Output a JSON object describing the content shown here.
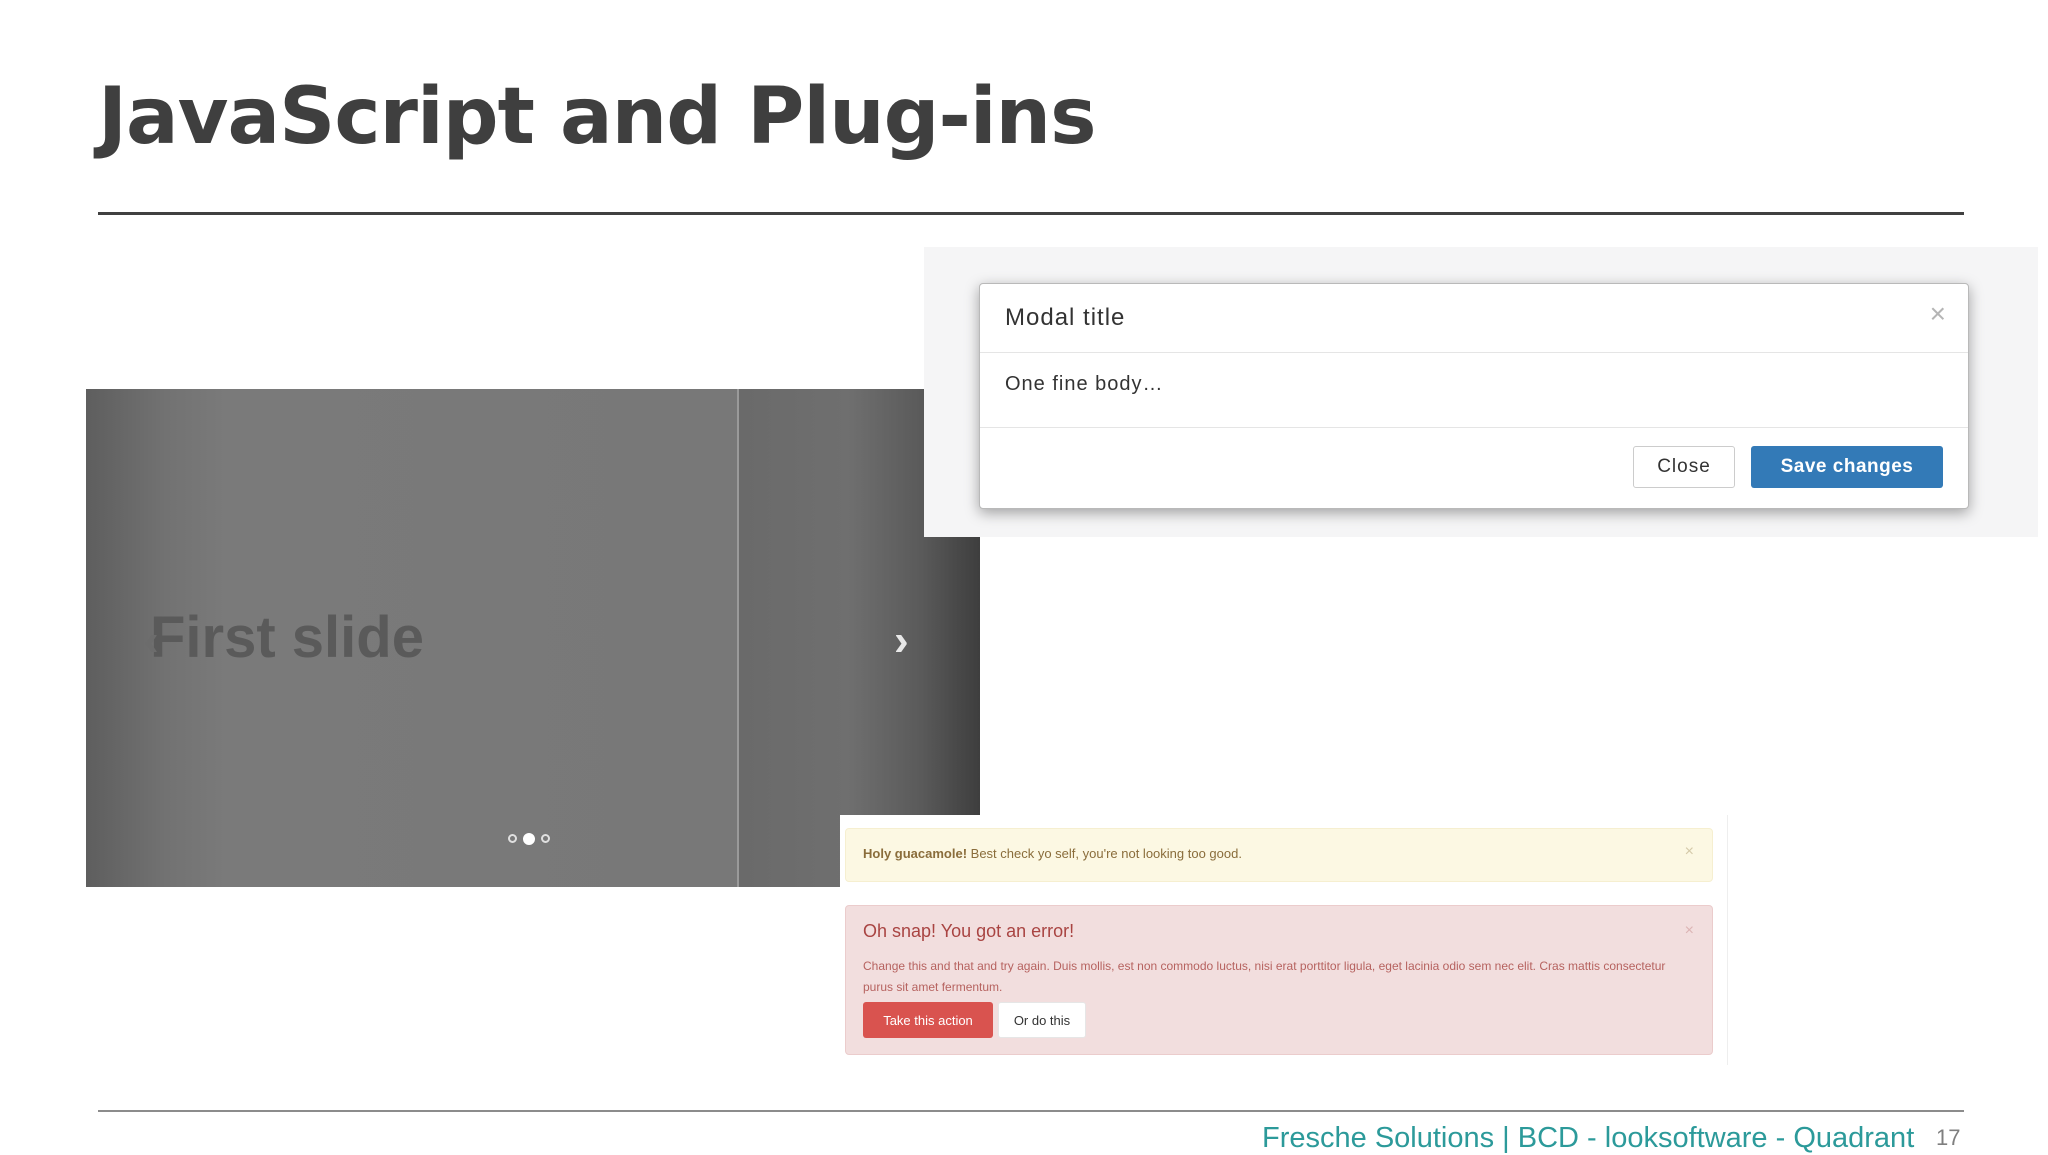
{
  "slide": {
    "title": "JavaScript and Plug-ins",
    "footer": "Fresche Solutions | BCD - looksoftware - Quadrant",
    "page_number": "17"
  },
  "carousel": {
    "caption": "First slide",
    "prev_icon": "chevron-left-icon",
    "next_icon": "chevron-right-icon",
    "prev_glyph": "‹",
    "next_glyph": "›",
    "indicator_count": 3,
    "active_index": 1
  },
  "modal": {
    "title": "Modal title",
    "close_glyph": "×",
    "body": "One fine body…",
    "close_label": "Close",
    "save_label": "Save changes",
    "primary_color": "#337ab7"
  },
  "alerts": {
    "warning": {
      "strong": "Holy guacamole!",
      "text": " Best check yo self, you're not looking too good.",
      "dismiss_glyph": "×"
    },
    "danger": {
      "heading": "Oh snap! You got an error!",
      "text": "Change this and that and try again. Duis mollis, est non commodo luctus, nisi erat porttitor ligula, eget lacinia odio sem nec elit. Cras mattis consectetur purus sit amet fermentum.",
      "action_label": "Take this action",
      "alt_label": "Or do this",
      "dismiss_glyph": "×",
      "danger_color": "#d9534f"
    }
  }
}
